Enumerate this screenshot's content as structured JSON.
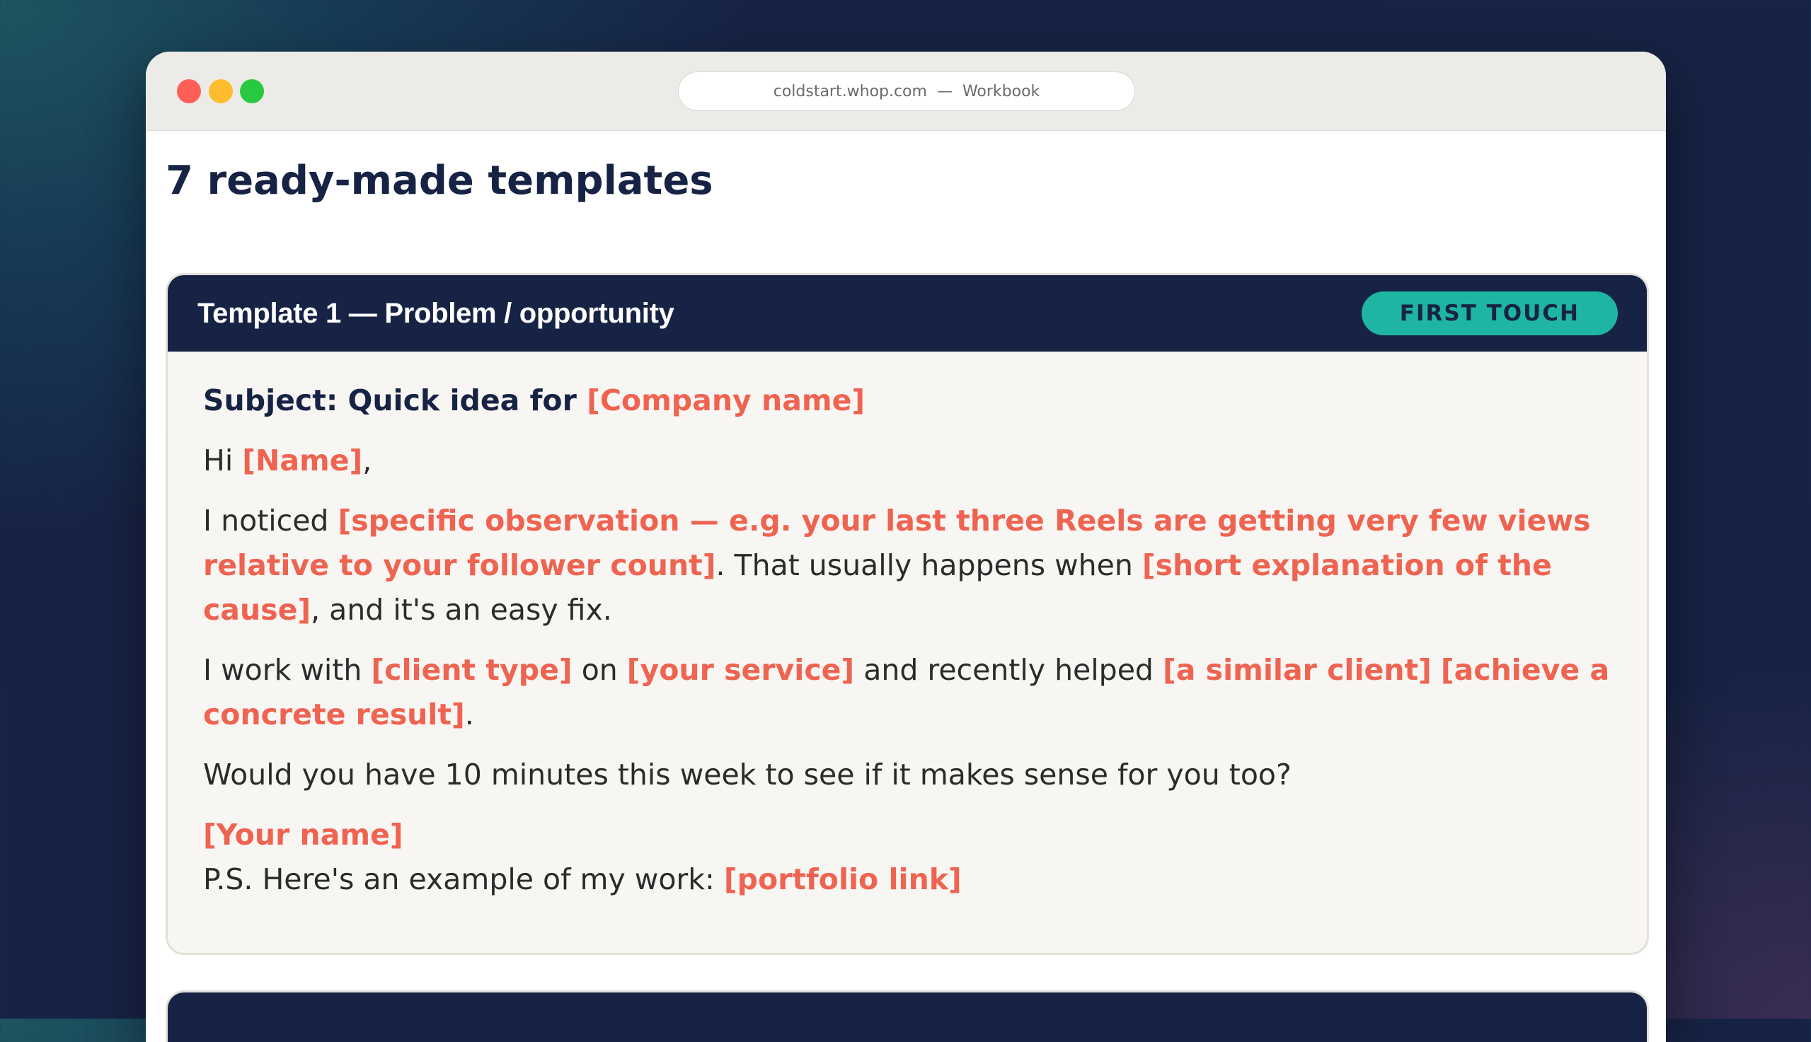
{
  "browser": {
    "domain": "coldstart.whop.com",
    "separator": "—",
    "page_name": "Workbook"
  },
  "page": {
    "title": "7 ready-made templates"
  },
  "templates": [
    {
      "title": "Template 1 — Problem / opportunity",
      "badge": "FIRST TOUCH",
      "subject_prefix": "Subject: Quick idea for ",
      "subject_placeholder": "[Company name]",
      "greeting": {
        "prefix": "Hi ",
        "placeholder": "[Name]",
        "suffix": ","
      },
      "para1": {
        "prefix": "I noticed ",
        "ph1": "[specific observation — e.g. your last three Reels are getting very few views relative to your follower count]",
        "middle": ". That usually happens when ",
        "ph2": "[short explanation of the cause]",
        "suffix": ", and it's an easy fix."
      },
      "para2": {
        "prefix": "I work with ",
        "ph1": "[client type]",
        "mid1": " on ",
        "ph2": "[your service]",
        "mid2": " and recently helped ",
        "ph3": "[a similar client]",
        "mid3": " ",
        "ph4": "[achieve a concrete result]",
        "suffix": "."
      },
      "para3": "Would you have 10 minutes this week to see if it makes sense for you too?",
      "signature": "[Your name]",
      "ps": {
        "prefix": "P.S. Here's an example of my work: ",
        "placeholder": "[portfolio link]"
      }
    }
  ],
  "colors": {
    "navy": "#172345",
    "placeholder": "#ef6351",
    "badge": "#1fb5a3"
  }
}
